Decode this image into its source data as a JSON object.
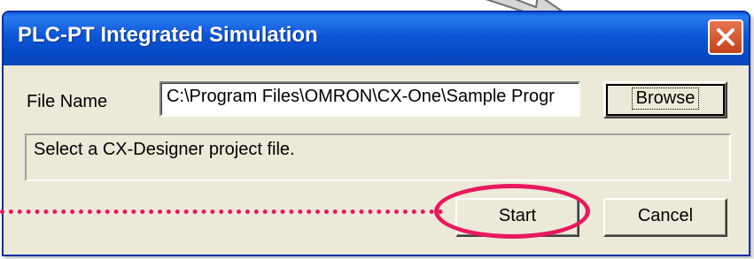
{
  "window": {
    "title": "PLC-PT Integrated Simulation"
  },
  "form": {
    "file_label": "File Name",
    "file_value": "C:\\Program Files\\OMRON\\CX-One\\Sample Progr",
    "browse_label": "Browse",
    "status_text": "Select a CX-Designer project file."
  },
  "actions": {
    "start_label": "Start",
    "cancel_label": "Cancel"
  },
  "colors": {
    "title_bar": "#0b55d6",
    "dialog_bg": "#ece9d8",
    "close_button": "#d9552f",
    "annotation": "#e8185d"
  },
  "icons": {
    "close": "close-icon",
    "background_arrow": "arrow-icon"
  }
}
